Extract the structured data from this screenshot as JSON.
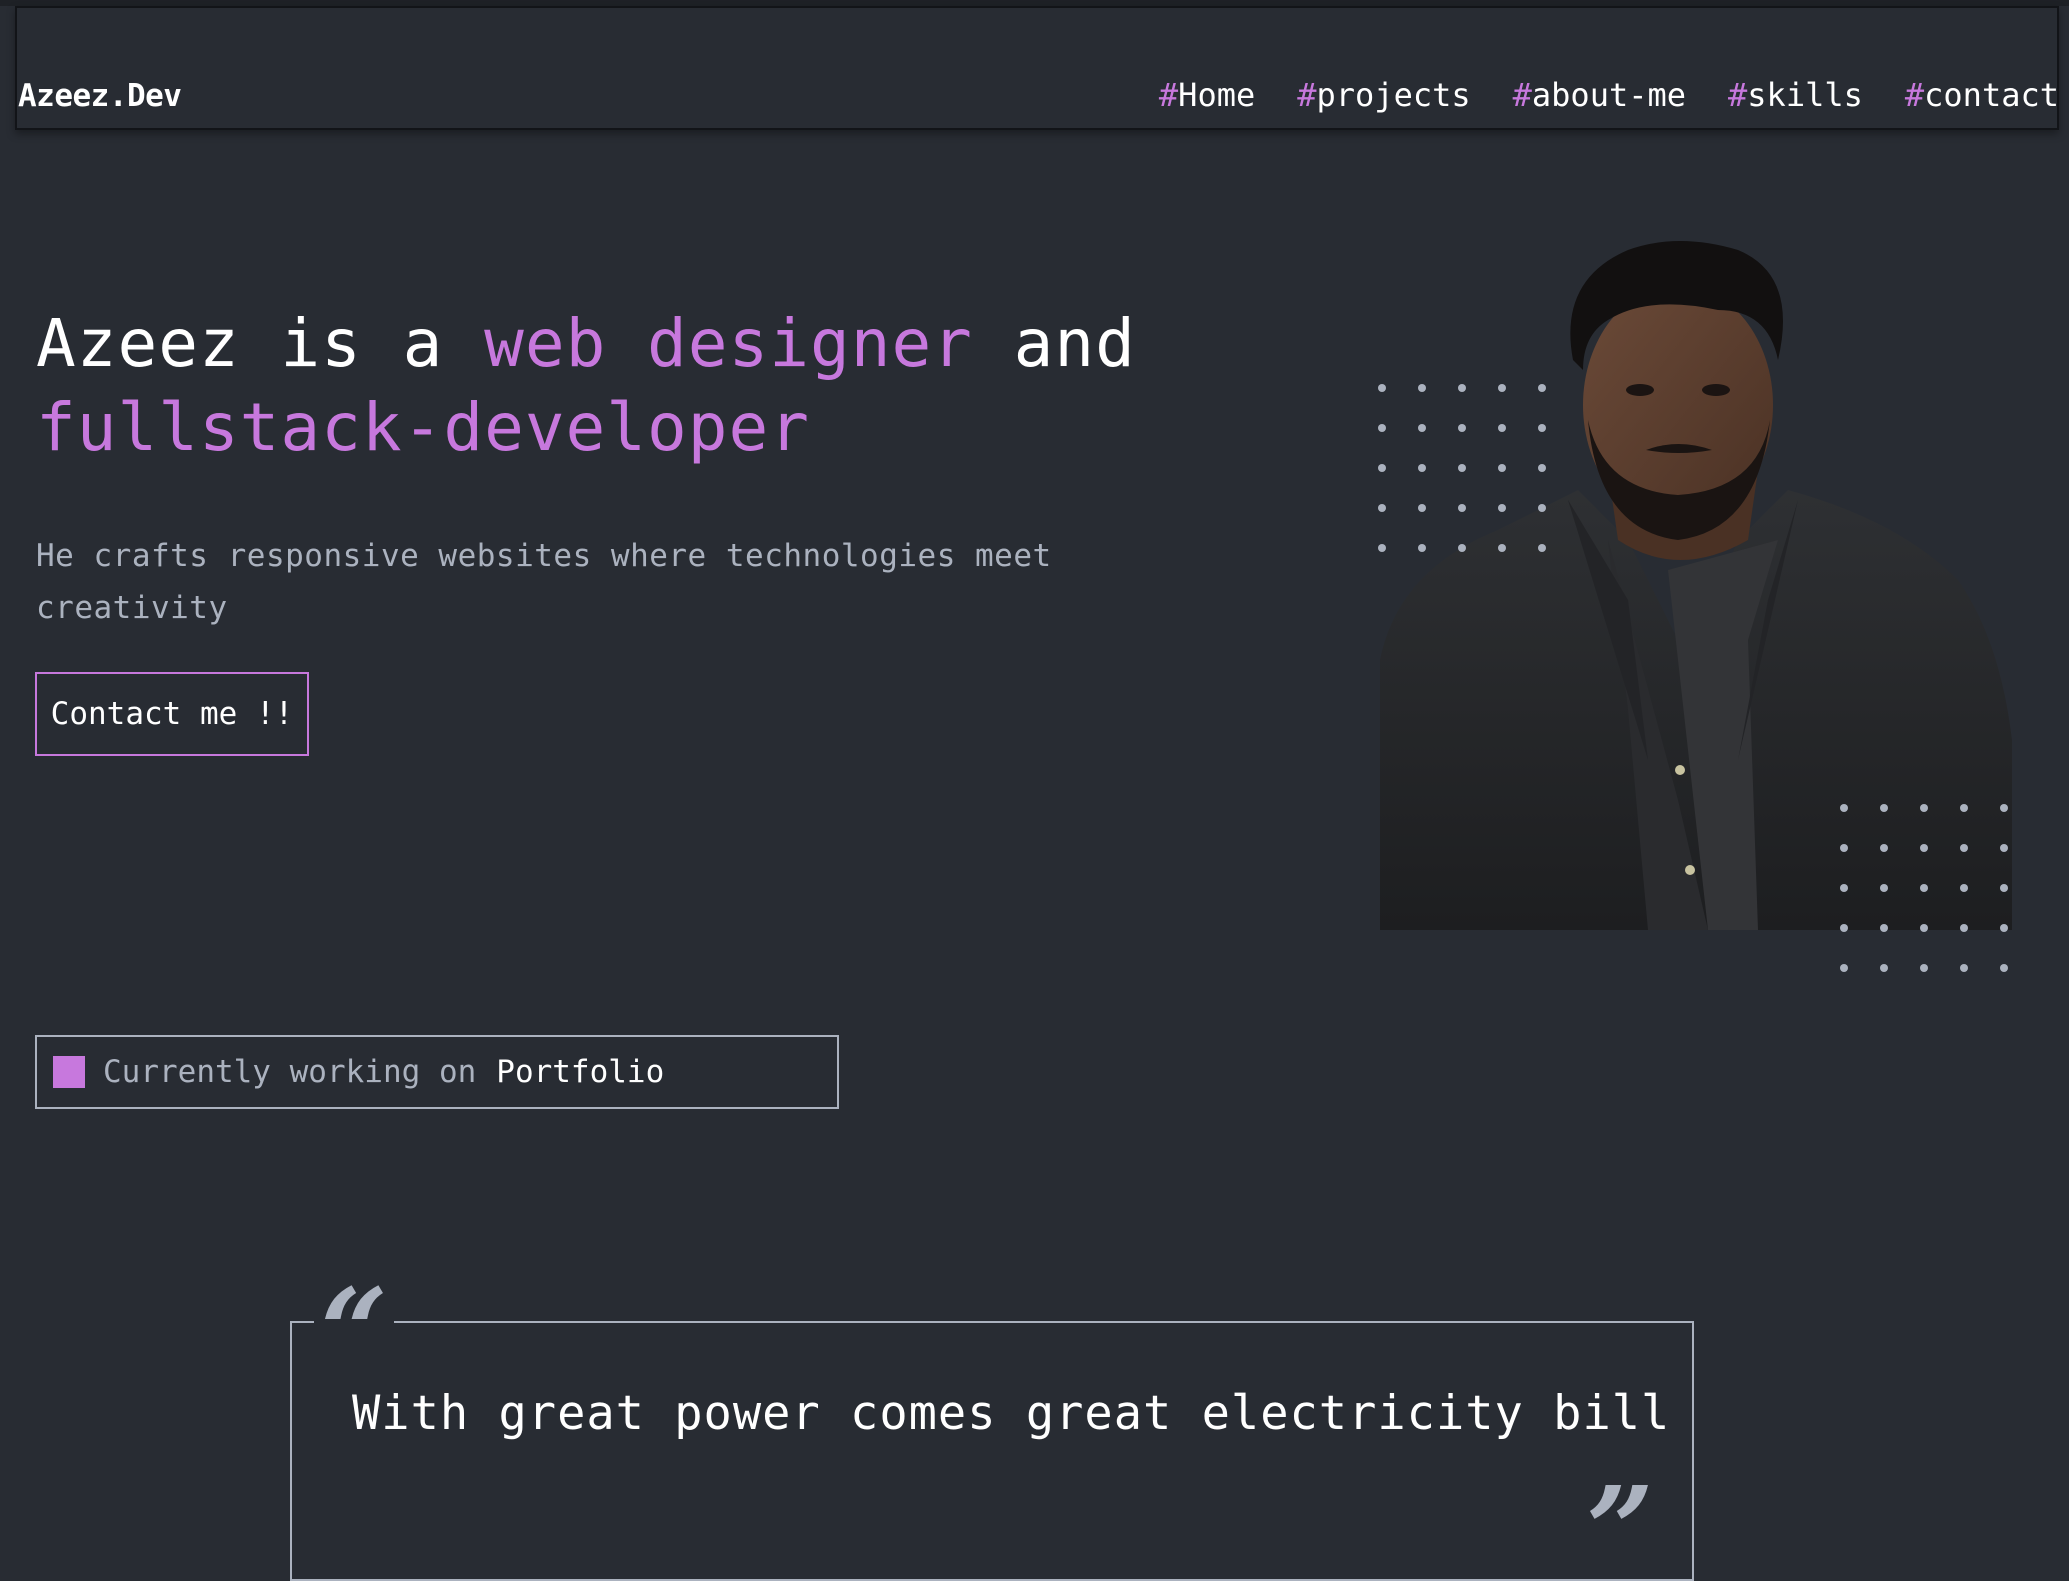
{
  "header": {
    "logo": "Azeez.Dev",
    "nav": [
      {
        "hash": "#",
        "label": "Home"
      },
      {
        "hash": "#",
        "label": "projects"
      },
      {
        "hash": "#",
        "label": "about-me"
      },
      {
        "hash": "#",
        "label": "skills"
      },
      {
        "hash": "#",
        "label": "contact"
      }
    ]
  },
  "hero": {
    "title_part1": "Azeez is a ",
    "title_accent1": "web designer",
    "title_part2": " and",
    "title_accent2": "fullstack-developer",
    "subtitle": "He crafts responsive websites where technologies meet creativity",
    "cta_label": "Contact me !!"
  },
  "status": {
    "prefix": "Currently working on",
    "project": "Portfolio"
  },
  "quote": {
    "open_mark": "“",
    "close_mark": "”",
    "text": "With great power comes great electricity bill"
  },
  "colors": {
    "background": "#282c33",
    "accent": "#c778dd",
    "muted": "#abb2bf",
    "text": "#ffffff"
  }
}
